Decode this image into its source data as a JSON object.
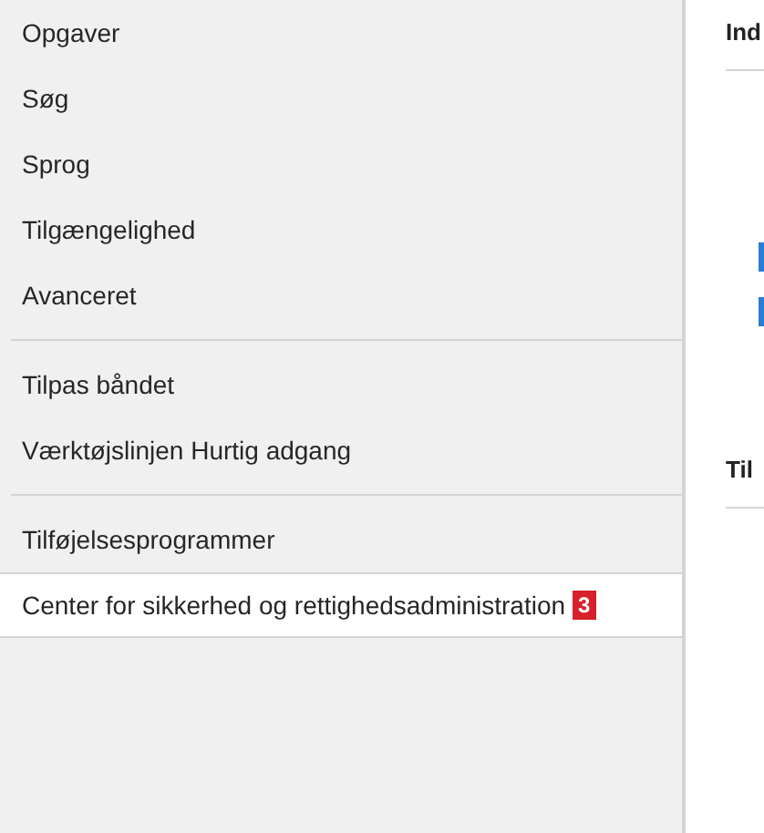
{
  "sidebar": {
    "groups": [
      {
        "items": [
          {
            "label": "Opgaver",
            "selected": false
          },
          {
            "label": "Søg",
            "selected": false
          },
          {
            "label": "Sprog",
            "selected": false
          },
          {
            "label": "Tilgængelighed",
            "selected": false
          },
          {
            "label": "Avanceret",
            "selected": false
          }
        ]
      },
      {
        "items": [
          {
            "label": "Tilpas båndet",
            "selected": false
          },
          {
            "label": "Værktøjslinjen Hurtig adgang",
            "selected": false
          }
        ]
      },
      {
        "items": [
          {
            "label": "Tilføjelsesprogrammer",
            "selected": false
          },
          {
            "label": "Center for sikkerhed og rettighedsadministration",
            "selected": true,
            "badge": "3"
          }
        ]
      }
    ]
  },
  "content": {
    "sections": [
      {
        "heading": "Ind"
      },
      {
        "heading": "Til"
      }
    ]
  }
}
